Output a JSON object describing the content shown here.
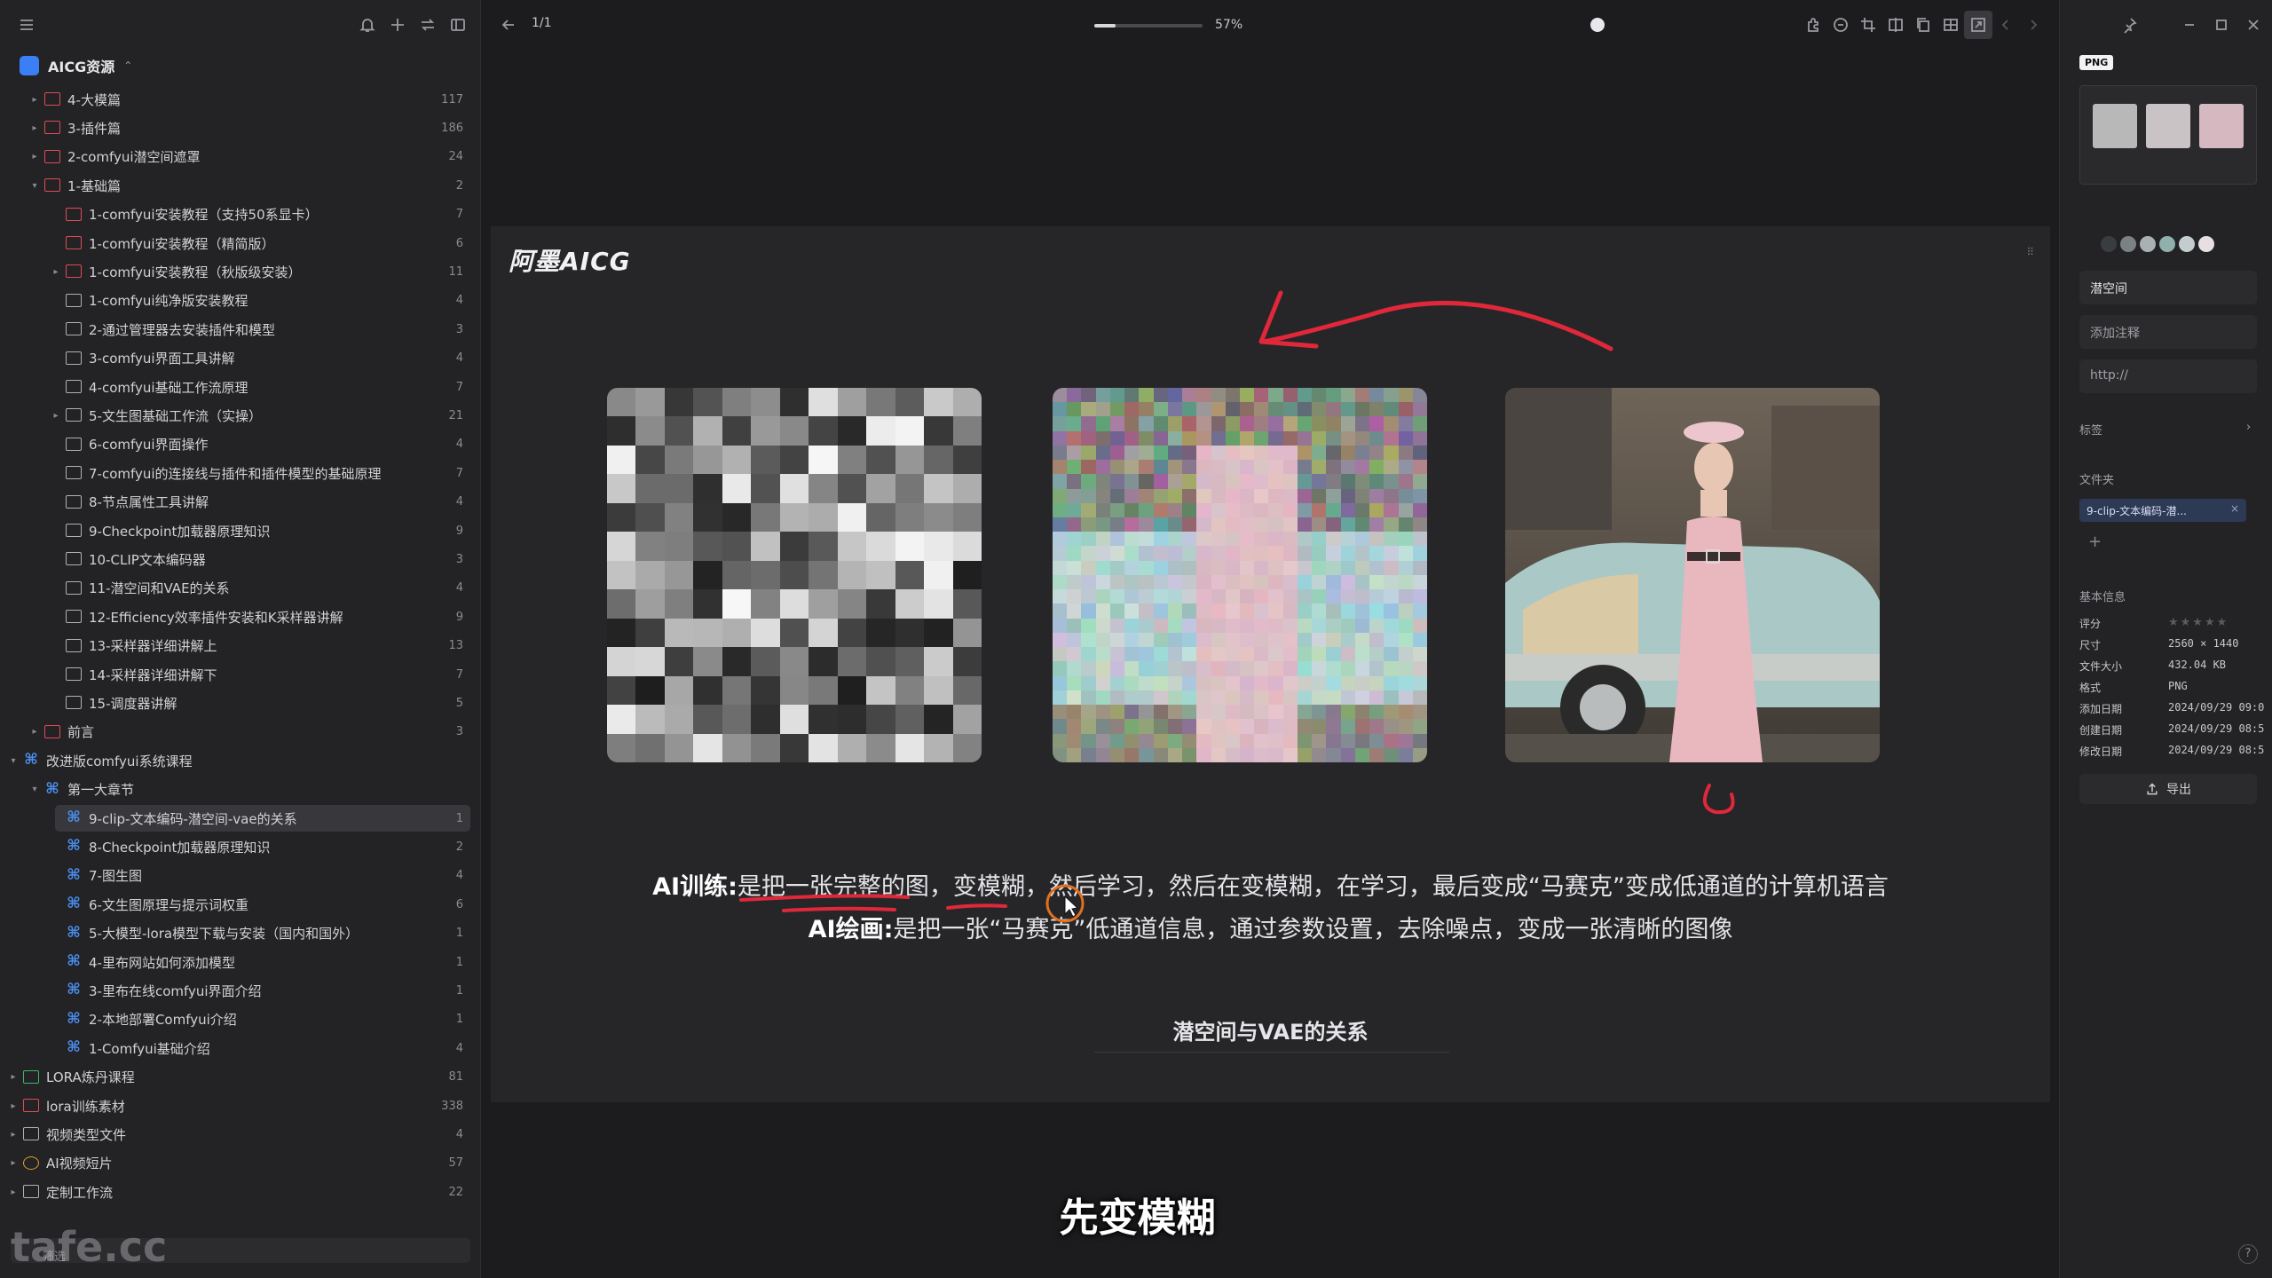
{
  "library": {
    "title": "AICG资源"
  },
  "tree": [
    {
      "label": "4-大模篇",
      "count": "117",
      "depth": 1,
      "arrow": "right",
      "icon": "red"
    },
    {
      "label": "3-插件篇",
      "count": "186",
      "depth": 1,
      "arrow": "right",
      "icon": "red"
    },
    {
      "label": "2-comfyui潜空间遮罩",
      "count": "24",
      "depth": 1,
      "arrow": "right",
      "icon": "red"
    },
    {
      "label": "1-基础篇",
      "count": "2",
      "depth": 1,
      "arrow": "down",
      "icon": "red"
    },
    {
      "label": "1-comfyui安装教程（支持50系显卡）",
      "count": "7",
      "depth": 2,
      "arrow": "",
      "icon": "red"
    },
    {
      "label": "1-comfyui安装教程（精简版）",
      "count": "6",
      "depth": 2,
      "arrow": "",
      "icon": "red"
    },
    {
      "label": "1-comfyui安装教程（秋版级安装）",
      "count": "11",
      "depth": 2,
      "arrow": "right",
      "icon": "red"
    },
    {
      "label": "1-comfyui纯净版安装教程",
      "count": "4",
      "depth": 2,
      "arrow": "",
      "icon": "plain"
    },
    {
      "label": "2-通过管理器去安装插件和模型",
      "count": "3",
      "depth": 2,
      "arrow": "",
      "icon": "plain"
    },
    {
      "label": "3-comfyui界面工具讲解",
      "count": "4",
      "depth": 2,
      "arrow": "",
      "icon": "plain"
    },
    {
      "label": "4-comfyui基础工作流原理",
      "count": "7",
      "depth": 2,
      "arrow": "",
      "icon": "plain"
    },
    {
      "label": "5-文生图基础工作流（实操）",
      "count": "21",
      "depth": 2,
      "arrow": "right",
      "icon": "plain"
    },
    {
      "label": "6-comfyui界面操作",
      "count": "4",
      "depth": 2,
      "arrow": "",
      "icon": "plain"
    },
    {
      "label": "7-comfyui的连接线与插件和插件模型的基础原理",
      "count": "7",
      "depth": 2,
      "arrow": "",
      "icon": "plain"
    },
    {
      "label": "8-节点属性工具讲解",
      "count": "4",
      "depth": 2,
      "arrow": "",
      "icon": "plain"
    },
    {
      "label": "9-Checkpoint加载器原理知识",
      "count": "9",
      "depth": 2,
      "arrow": "",
      "icon": "plain"
    },
    {
      "label": "10-CLIP文本编码器",
      "count": "3",
      "depth": 2,
      "arrow": "",
      "icon": "plain"
    },
    {
      "label": "11-潜空间和VAE的关系",
      "count": "4",
      "depth": 2,
      "arrow": "",
      "icon": "plain"
    },
    {
      "label": "12-Efficiency效率插件安装和K采样器讲解",
      "count": "9",
      "depth": 2,
      "arrow": "",
      "icon": "plain"
    },
    {
      "label": "13-采样器详细讲解上",
      "count": "13",
      "depth": 2,
      "arrow": "",
      "icon": "plain"
    },
    {
      "label": "14-采样器详细讲解下",
      "count": "7",
      "depth": 2,
      "arrow": "",
      "icon": "plain"
    },
    {
      "label": "15-调度器讲解",
      "count": "5",
      "depth": 2,
      "arrow": "",
      "icon": "plain"
    },
    {
      "label": "前言",
      "count": "3",
      "depth": 1,
      "arrow": "right",
      "icon": "red"
    },
    {
      "label": "改进版comfyui系统课程",
      "count": "",
      "depth": 0,
      "arrow": "down",
      "icon": "smart"
    },
    {
      "label": "第一大章节",
      "count": "",
      "depth": 1,
      "arrow": "down",
      "icon": "smart"
    },
    {
      "label": "9-clip-文本编码-潜空间-vae的关系",
      "count": "1",
      "depth": 2,
      "arrow": "",
      "icon": "smart",
      "selected": true
    },
    {
      "label": "8-Checkpoint加载器原理知识",
      "count": "2",
      "depth": 2,
      "arrow": "",
      "icon": "smart"
    },
    {
      "label": "7-图生图",
      "count": "4",
      "depth": 2,
      "arrow": "",
      "icon": "smart"
    },
    {
      "label": "6-文生图原理与提示词权重",
      "count": "6",
      "depth": 2,
      "arrow": "",
      "icon": "smart"
    },
    {
      "label": "5-大模型-lora模型下载与安装（国内和国外）",
      "count": "1",
      "depth": 2,
      "arrow": "",
      "icon": "smart"
    },
    {
      "label": "4-里布网站如何添加模型",
      "count": "1",
      "depth": 2,
      "arrow": "",
      "icon": "smart"
    },
    {
      "label": "3-里布在线comfyui界面介绍",
      "count": "1",
      "depth": 2,
      "arrow": "",
      "icon": "smart"
    },
    {
      "label": "2-本地部署Comfyui介绍",
      "count": "1",
      "depth": 2,
      "arrow": "",
      "icon": "smart"
    },
    {
      "label": "1-Comfyui基础介绍",
      "count": "4",
      "depth": 2,
      "arrow": "",
      "icon": "smart"
    },
    {
      "label": "LORA炼丹课程",
      "count": "81",
      "depth": 0,
      "arrow": "right",
      "icon": "green"
    },
    {
      "label": "lora训练素材",
      "count": "338",
      "depth": 0,
      "arrow": "right",
      "icon": "red"
    },
    {
      "label": "视频类型文件",
      "count": "4",
      "depth": 0,
      "arrow": "right",
      "icon": "plain"
    },
    {
      "label": "AI视频短片",
      "count": "57",
      "depth": 0,
      "arrow": "right",
      "icon": "gold"
    },
    {
      "label": "定制工作流",
      "count": "22",
      "depth": 0,
      "arrow": "right",
      "icon": "plain"
    }
  ],
  "filter": {
    "label": "筛选"
  },
  "watermark": "tafe.cc",
  "viewer": {
    "page_indicator": "1/1",
    "zoom_percent": 57,
    "zoom_label": "57%"
  },
  "slide": {
    "brand": "阿墨AICG",
    "caption1_bold": "AI训练:",
    "caption1_text": "是把一张完整的图，变模糊，然后学习，然后在变模糊，在学习，最后变成“马赛克”变成低通道的计算机语言",
    "caption2_bold": "AI绘画:",
    "caption2_text": "是把一张“马赛克”低通道信息，通过参数设置，去除噪点，变成一张清晰的图像",
    "subtitle": "潜空间与VAE的关系"
  },
  "video_subtitle": "先变模糊",
  "inspector": {
    "format_badge": "PNG",
    "name_field": "潜空间",
    "note_placeholder": "添加注释",
    "url_placeholder": "http://",
    "tags_label": "标签",
    "folder_label": "文件夹",
    "folder_chip": "9-clip-文本编码-潜...",
    "basic_info_label": "基本信息",
    "info": [
      {
        "k": "评分",
        "v": ""
      },
      {
        "k": "尺寸",
        "v": "2560 × 1440"
      },
      {
        "k": "文件大小",
        "v": "432.04 KB"
      },
      {
        "k": "格式",
        "v": "PNG"
      },
      {
        "k": "添加日期",
        "v": "2024/09/29 09:0"
      },
      {
        "k": "创建日期",
        "v": "2024/09/29 08:5"
      },
      {
        "k": "修改日期",
        "v": "2024/09/29 08:5"
      }
    ],
    "export_label": "导出",
    "swatch_colors": [
      "#3a3d3f",
      "#7a8286",
      "#a9b1b3",
      "#8fb0ac",
      "#c3cdd0",
      "#e8dfe2"
    ]
  },
  "colors": {
    "accent": "#3a7ff6",
    "annotation": "#e0283a",
    "selected_row": "#38383c"
  }
}
